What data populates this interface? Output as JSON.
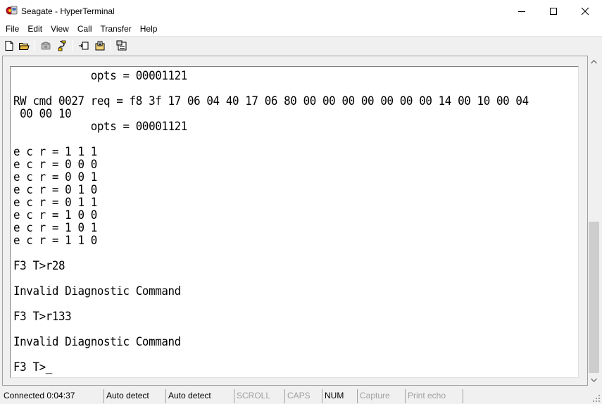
{
  "window": {
    "title": "Seagate - HyperTerminal"
  },
  "menu": {
    "items": [
      "File",
      "Edit",
      "View",
      "Call",
      "Transfer",
      "Help"
    ]
  },
  "toolbar": {
    "buttons": [
      "new-document-icon",
      "open-folder-icon",
      "phone-icon",
      "disconnect-icon",
      "send-icon",
      "receive-icon",
      "properties-icon"
    ]
  },
  "terminal": {
    "lines": [
      "            opts = 00001121",
      "",
      "RW cmd 0027 req = f8 3f 17 06 04 40 17 06 80 00 00 00 00 00 00 00 14 00 10 00 04",
      " 00 00 10",
      "            opts = 00001121",
      "",
      "e c r = 1 1 1",
      "e c r = 0 0 0",
      "e c r = 0 0 1",
      "e c r = 0 1 0",
      "e c r = 0 1 1",
      "e c r = 1 0 0",
      "e c r = 1 0 1",
      "e c r = 1 1 0",
      "",
      "F3 T>r28",
      "",
      "Invalid Diagnostic Command",
      "",
      "F3 T>r133",
      "",
      "Invalid Diagnostic Command",
      "",
      "F3 T>"
    ],
    "cursor": "_"
  },
  "status": {
    "connected": "Connected 0:04:37",
    "detect1": "Auto detect",
    "detect2": "Auto detect",
    "scroll": "SCROLL",
    "caps": "CAPS",
    "num": "NUM",
    "capture": "Capture",
    "print_echo": "Print echo"
  }
}
